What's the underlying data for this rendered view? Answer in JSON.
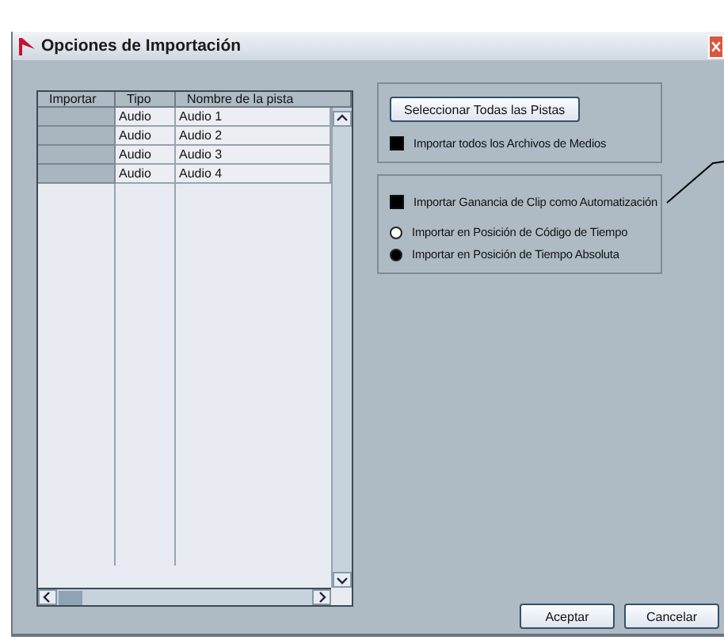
{
  "window": {
    "title": "Opciones de Importación"
  },
  "table": {
    "columns": [
      "Importar",
      "Tipo",
      "Nombre de la pista"
    ],
    "rows": [
      {
        "type": "Audio",
        "name": "Audio 1"
      },
      {
        "type": "Audio",
        "name": "Audio 2"
      },
      {
        "type": "Audio",
        "name": "Audio 3"
      },
      {
        "type": "Audio",
        "name": "Audio 4"
      }
    ]
  },
  "select_all_button": "Seleccionar Todas las Pistas",
  "groups": [
    [
      {
        "kind": "checkbox",
        "label": "Importar todos los Archivos de Medios",
        "checked": true
      }
    ],
    [
      {
        "kind": "checkbox",
        "label": "Importar Ganancia de Clip como Automatización",
        "checked": true
      },
      {
        "kind": "radio",
        "label": "Importar en Posición de Código de Tiempo",
        "selected": false
      },
      {
        "kind": "radio",
        "label": "Importar en Posición de Tiempo Absoluta",
        "selected": true
      }
    ]
  ],
  "buttons": [
    "Aceptar",
    "Cancelar"
  ]
}
